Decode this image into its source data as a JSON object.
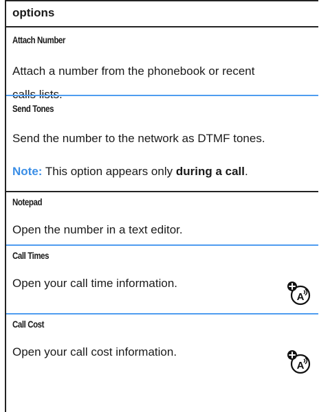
{
  "header": {
    "title": "options"
  },
  "rows": [
    {
      "name": "Attach Number",
      "desc_line1": "Attach a number from the phonebook or recent",
      "desc_line2": "calls lists."
    },
    {
      "name": "Send Tones",
      "desc": "Send the number to the network as DTMF tones.",
      "note_label": "Note:",
      "note_text": "This option appears only",
      "note_bold": "during a call",
      "note_end": "."
    },
    {
      "name": "Notepad",
      "desc": "Open the number in a text editor."
    },
    {
      "name": "Call Times",
      "desc": "Open your call time information.",
      "icon": "network-dependent-feature-icon"
    },
    {
      "name": "Call Cost",
      "desc": "Open your call cost information.",
      "icon": "network-dependent-feature-icon"
    }
  ],
  "colors": {
    "separator": "#4e9cf0",
    "note_label": "#3a8ee6",
    "border": "#222222"
  }
}
